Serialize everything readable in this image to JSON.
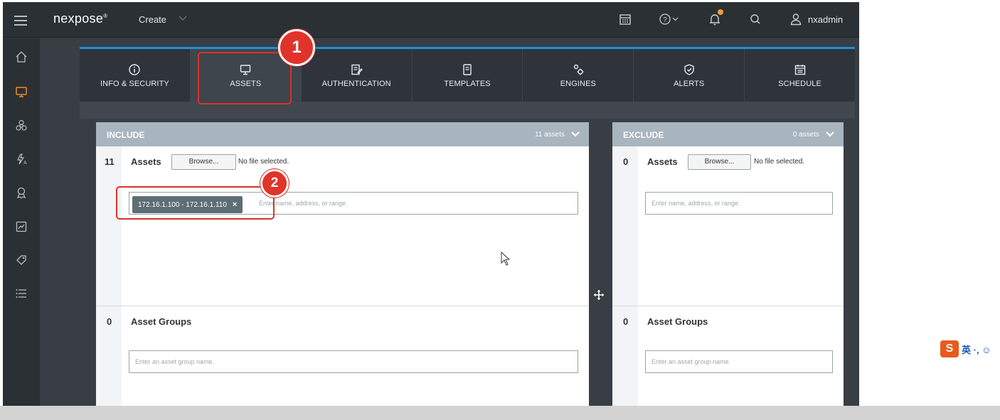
{
  "colors": {
    "accent_blue": "#1e8fd6",
    "annotation_red": "#e0332a",
    "panel_header": "#a8b4be",
    "notification_dot": "#f0a032",
    "chip_bg": "#5e6e75"
  },
  "topnav": {
    "brand": "nexpose",
    "brand_mark": "®",
    "create_label": "Create",
    "icons": [
      "calendar-icon",
      "help-icon",
      "notification-bell-icon",
      "search-icon",
      "user-icon"
    ],
    "username": "nxadmin"
  },
  "sidebar": {
    "icons": [
      "home-icon",
      "assets-monitor-icon",
      "vulnerabilities-biohazard-icon",
      "policies-icon",
      "remediation-ribbon-icon",
      "reports-icon",
      "tags-icon",
      "administration-list-icon"
    ]
  },
  "tabs": [
    {
      "label": "INFO & SECURITY",
      "icon": "info-icon"
    },
    {
      "label": "ASSETS",
      "icon": "monitor-icon"
    },
    {
      "label": "AUTHENTICATION",
      "icon": "credential-icon"
    },
    {
      "label": "TEMPLATES",
      "icon": "template-icon"
    },
    {
      "label": "ENGINES",
      "icon": "engines-gear-icon"
    },
    {
      "label": "ALERTS",
      "icon": "shield-check-icon"
    },
    {
      "label": "SCHEDULE",
      "icon": "calendar-icon"
    }
  ],
  "include": {
    "title": "INCLUDE",
    "count_label": "11 assets",
    "assets": {
      "count": "11",
      "label": "Assets",
      "browse_label": "Browse...",
      "file_status": "No file selected.",
      "chip": "172.16.1.100 - 172.16.1.110",
      "chip_remove": "×",
      "placeholder": "Enter name, address, or range."
    },
    "asset_groups": {
      "count": "0",
      "label": "Asset Groups",
      "placeholder": "Enter an asset group name."
    }
  },
  "exclude": {
    "title": "EXCLUDE",
    "count_label": "0 assets",
    "assets": {
      "count": "0",
      "label": "Assets",
      "browse_label": "Browse...",
      "file_status": "No file selected.",
      "placeholder": "Enter name, address, or range."
    },
    "asset_groups": {
      "count": "0",
      "label": "Asset Groups",
      "placeholder": "Enter an asset group name."
    }
  },
  "annotations": {
    "step1": "1",
    "step2": "2"
  },
  "ime": {
    "logo": "S",
    "text": "英 ·, ☺"
  }
}
